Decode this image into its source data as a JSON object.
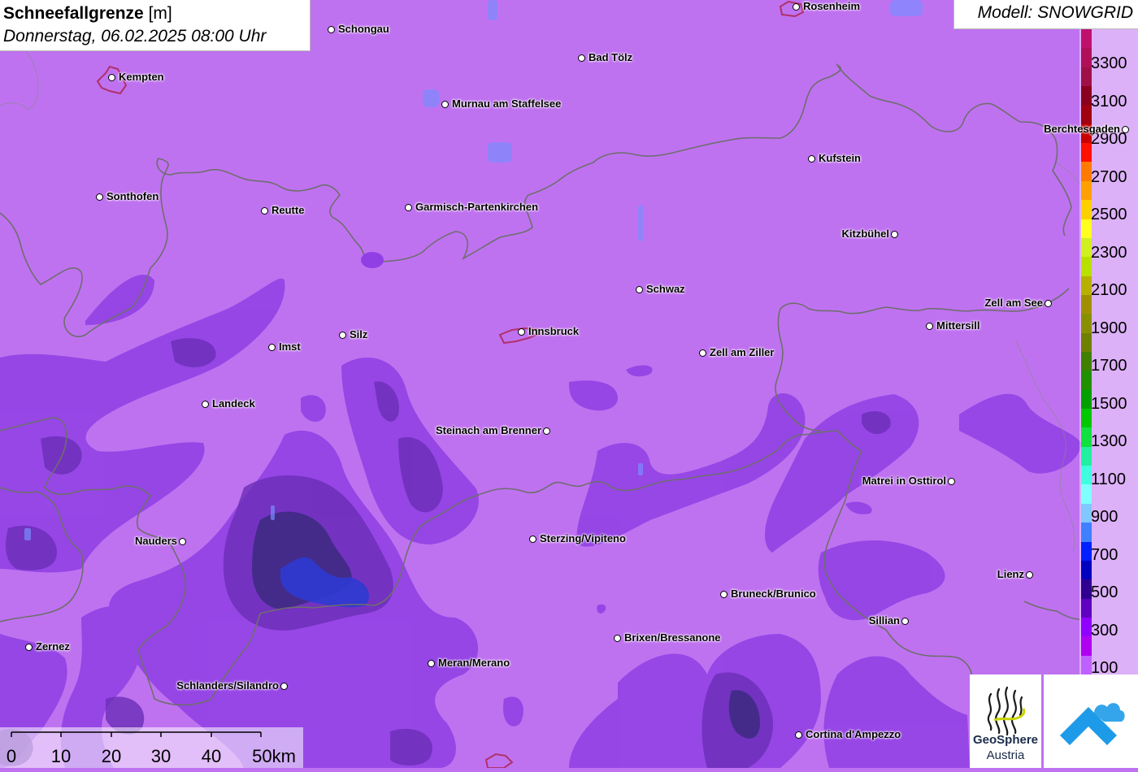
{
  "header": {
    "title_bold": "Schneefallgrenze",
    "title_unit": " [m]",
    "subtitle": "Donnerstag, 06.02.2025 08:00 Uhr",
    "model": "Modell: SNOWGRID"
  },
  "legend": {
    "labels": [
      "3300",
      "3100",
      "2900",
      "2700",
      "2500",
      "2300",
      "2100",
      "1900",
      "1700",
      "1500",
      "1300",
      "1100",
      "900",
      "700",
      "500",
      "300",
      "100"
    ],
    "colors": [
      "#c0106e",
      "#b0105a",
      "#a01048",
      "#8a0020",
      "#a00010",
      "#c80000",
      "#ff1000",
      "#ff7a00",
      "#ffa000",
      "#ffd000",
      "#ffff20",
      "#d0f020",
      "#b8e000",
      "#b8b000",
      "#a09000",
      "#889000",
      "#708000",
      "#408000",
      "#209000",
      "#00a000",
      "#00c800",
      "#10e040",
      "#20f0a0",
      "#40ffe0",
      "#80ffff",
      "#80c8ff",
      "#4080ff",
      "#0020ff",
      "#0000c0",
      "#300090",
      "#6000c0",
      "#9000ff",
      "#b000f0",
      "#c060ff"
    ]
  },
  "cities": [
    {
      "name": "Rosenheim",
      "side": "right"
    },
    {
      "name": "Schongau",
      "side": "right"
    },
    {
      "name": "Kempten",
      "side": "right"
    },
    {
      "name": "Bad Tölz",
      "side": "right"
    },
    {
      "name": "Murnau am Staffelsee",
      "side": "right"
    },
    {
      "name": "Berchtesgaden",
      "side": "left"
    },
    {
      "name": "Kufstein",
      "side": "right"
    },
    {
      "name": "Sonthofen",
      "side": "right"
    },
    {
      "name": "Reutte",
      "side": "right"
    },
    {
      "name": "Garmisch-Partenkirchen",
      "side": "right"
    },
    {
      "name": "Kitzbühel",
      "side": "left"
    },
    {
      "name": "Schwaz",
      "side": "right"
    },
    {
      "name": "Zell am See",
      "side": "left"
    },
    {
      "name": "Mittersill",
      "side": "right"
    },
    {
      "name": "Silz",
      "side": "right"
    },
    {
      "name": "Innsbruck",
      "side": "right"
    },
    {
      "name": "Imst",
      "side": "right"
    },
    {
      "name": "Zell am Ziller",
      "side": "right"
    },
    {
      "name": "Landeck",
      "side": "right"
    },
    {
      "name": "Steinach am Brenner",
      "side": "left"
    },
    {
      "name": "Matrei in Osttirol",
      "side": "left"
    },
    {
      "name": "Nauders",
      "side": "left"
    },
    {
      "name": "Sterzing/Vipiteno",
      "side": "right"
    },
    {
      "name": "Lienz",
      "side": "left"
    },
    {
      "name": "Bruneck/Brunico",
      "side": "right"
    },
    {
      "name": "Sillian",
      "side": "left"
    },
    {
      "name": "Zernez",
      "side": "right"
    },
    {
      "name": "Brixen/Bressanone",
      "side": "right"
    },
    {
      "name": "Meran/Merano",
      "side": "right"
    },
    {
      "name": "Schlanders/Silandro",
      "side": "left"
    },
    {
      "name": "Cortina d'Ampezzo",
      "side": "right"
    }
  ],
  "scale": {
    "labels": [
      "0",
      "10",
      "20",
      "30",
      "40",
      "50km"
    ]
  },
  "logos": {
    "geosphere_line1": "GeoSphere",
    "geosphere_line2": "Austria"
  },
  "colors": {
    "background": "#bf72f0",
    "band_300": "#8a3fe0",
    "band_500": "#6a2bb0",
    "band_700": "#3b2a7a",
    "band_900": "#2e3ad0",
    "border": "#6e6e6e",
    "urban": "#b0306a"
  }
}
